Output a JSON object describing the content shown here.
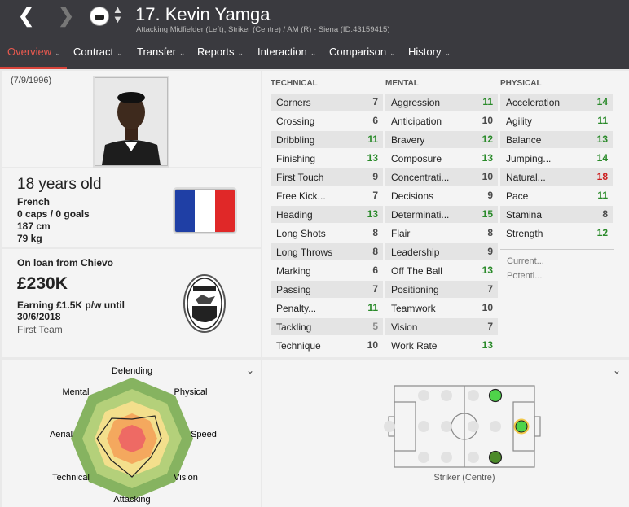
{
  "header": {
    "title": "17. Kevin Yamga",
    "subtitle": "Attacking Midfielder (Left), Striker (Centre) / AM (R) - Siena (ID:43159415)"
  },
  "tabs": [
    {
      "label": "Overview"
    },
    {
      "label": "Contract"
    },
    {
      "label": "Transfer"
    },
    {
      "label": "Reports"
    },
    {
      "label": "Interaction"
    },
    {
      "label": "Comparison"
    },
    {
      "label": "History"
    }
  ],
  "profile": {
    "dob": "(7/9/1996)",
    "age": "18 years old",
    "nationality": "French",
    "caps": "0 caps / 0 goals",
    "height": "187 cm",
    "weight": "79 kg",
    "loan": "On loan from Chievo",
    "value": "£230K",
    "wage_line1": "Earning £1.5K p/w until",
    "wage_line2": "30/6/2018",
    "squad": "First Team",
    "flag_colors": [
      "#1f3fa5",
      "#ffffff",
      "#e02828"
    ]
  },
  "sections": {
    "technical": "TECHNICAL",
    "mental": "MENTAL",
    "physical": "PHYSICAL"
  },
  "technical": [
    {
      "name": "Corners",
      "value": "7"
    },
    {
      "name": "Crossing",
      "value": "6"
    },
    {
      "name": "Dribbling",
      "value": "11"
    },
    {
      "name": "Finishing",
      "value": "13"
    },
    {
      "name": "First Touch",
      "value": "9"
    },
    {
      "name": "Free Kick...",
      "value": "7"
    },
    {
      "name": "Heading",
      "value": "13"
    },
    {
      "name": "Long Shots",
      "value": "8"
    },
    {
      "name": "Long Throws",
      "value": "8"
    },
    {
      "name": "Marking",
      "value": "6"
    },
    {
      "name": "Passing",
      "value": "7"
    },
    {
      "name": "Penalty...",
      "value": "11"
    },
    {
      "name": "Tackling",
      "value": "5"
    },
    {
      "name": "Technique",
      "value": "10"
    }
  ],
  "mental": [
    {
      "name": "Aggression",
      "value": "11"
    },
    {
      "name": "Anticipation",
      "value": "10"
    },
    {
      "name": "Bravery",
      "value": "12"
    },
    {
      "name": "Composure",
      "value": "13"
    },
    {
      "name": "Concentrati...",
      "value": "10"
    },
    {
      "name": "Decisions",
      "value": "9"
    },
    {
      "name": "Determinati...",
      "value": "15"
    },
    {
      "name": "Flair",
      "value": "8"
    },
    {
      "name": "Leadership",
      "value": "9"
    },
    {
      "name": "Off The Ball",
      "value": "13"
    },
    {
      "name": "Positioning",
      "value": "7"
    },
    {
      "name": "Teamwork",
      "value": "10"
    },
    {
      "name": "Vision",
      "value": "7"
    },
    {
      "name": "Work Rate",
      "value": "13"
    }
  ],
  "physical": [
    {
      "name": "Acceleration",
      "value": "14"
    },
    {
      "name": "Agility",
      "value": "11"
    },
    {
      "name": "Balance",
      "value": "13"
    },
    {
      "name": "Jumping...",
      "value": "14"
    },
    {
      "name": "Natural...",
      "value": "18"
    },
    {
      "name": "Pace",
      "value": "11"
    },
    {
      "name": "Stamina",
      "value": "8"
    },
    {
      "name": "Strength",
      "value": "12"
    }
  ],
  "ability": {
    "current": "Current...",
    "potential": "Potenti..."
  },
  "radar": {
    "labels": [
      "Defending",
      "Physical",
      "Speed",
      "Vision",
      "Attacking",
      "Technical",
      "Aerial",
      "Mental"
    ]
  },
  "pitch": {
    "position_label": "Striker (Centre)"
  },
  "icons": {
    "back": "chevron-left-icon",
    "forward": "chevron-right-icon",
    "updown": "up-down-arrows-icon",
    "dropdown": "chevron-down-icon"
  }
}
